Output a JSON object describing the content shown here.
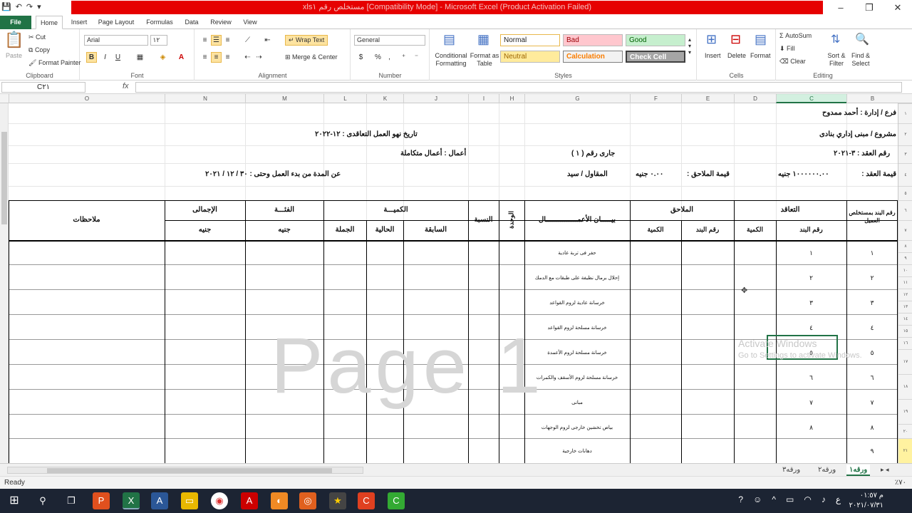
{
  "window": {
    "title": "xlsمستخلص رقم ١ [Compatibility Mode] - Microsoft Excel (Product Activation Failed)",
    "minimize": "‒",
    "restore": "❐",
    "close": "✕"
  },
  "qat": {
    "save": "💾",
    "undo": "↶",
    "redo": "↷",
    "more": "▾"
  },
  "ribbon_tabs": [
    "File",
    "Home",
    "Insert",
    "Page Layout",
    "Formulas",
    "Data",
    "Review",
    "View"
  ],
  "clipboard": {
    "paste": "Paste",
    "cut": "Cut",
    "copy": "Copy",
    "format_painter": "Format Painter",
    "label": "Clipboard"
  },
  "font": {
    "name": "Arial",
    "size": "١٢",
    "bold": "B",
    "italic": "I",
    "underline": "U",
    "label": "Font"
  },
  "alignment": {
    "wrap_text": "Wrap Text",
    "merge_center": "Merge & Center",
    "label": "Alignment"
  },
  "number": {
    "format": "General",
    "percent": "%",
    "comma": ",",
    "label": "Number"
  },
  "styles": {
    "conditional": "Conditional Formatting",
    "format_table": "Format as Table",
    "normal": "Normal",
    "bad": "Bad",
    "good": "Good",
    "neutral": "Neutral",
    "calculation": "Calculation",
    "check_cell": "Check Cell",
    "label": "Styles"
  },
  "cells": {
    "insert": "Insert",
    "delete": "Delete",
    "format": "Format",
    "label": "Cells"
  },
  "editing": {
    "autosum": "AutoSum",
    "fill": "Fill",
    "clear": "Clear",
    "sort": "Sort & Filter",
    "find": "Find & Select",
    "label": "Editing"
  },
  "formula_bar": {
    "name_box": "C٢١",
    "fx": "fx",
    "value": ""
  },
  "columns": [
    "O",
    "N",
    "M",
    "L",
    "K",
    "J",
    "I",
    "H",
    "G",
    "F",
    "E",
    "D",
    "C",
    "B"
  ],
  "rows": [
    "١",
    "٢",
    "٣",
    "٤",
    "٥",
    "٦",
    "٧",
    "٨",
    "٩",
    "١٠",
    "١١",
    "١٢",
    "١٣",
    "١٤",
    "١٥",
    "١٦",
    "١٧",
    "١٨",
    "١٩",
    "٢٠",
    "٢١"
  ],
  "sheet": {
    "branch": "فرع / إدارة : أحمد ممدوح",
    "project": "مشروع / مبنى إداري بنادى",
    "period_end": "تاريخ نهو العمل التعاقدى : ١٢-٢٠٢٢",
    "contract_no": "رقم العقد : ٣-٢٠٢١",
    "running": "جارى  رقم  (  ١  )",
    "works": "أعمال : أعمال متكاملة",
    "contract_value_label": "قيمة العقد :",
    "contract_value": "١٠٠٠٠٠٠.٠٠ جنيه",
    "addendum_label": "قيمة الملاحق :",
    "addendum_value": "٠.٠٠ جنيه",
    "contractor": "المقاول / سيد",
    "duration": "عن المدة من بدء العمل وحتى :  ٣٠ /  ١٢  /  ٢٠٢١",
    "headers": {
      "item_no": "رقم البند بمستخلص العميل",
      "contract": "التعاقد",
      "contract_item": "رقم البند",
      "contract_qty": "الكمية",
      "addenda": "الملاحق",
      "addenda_item": "رقم البند",
      "addenda_qty": "الكمية",
      "description": "بيـــــان الأعمـــــــــــــــال",
      "unit": "الوحدة",
      "ratio": "النسبة",
      "quantity": "الكميـــة",
      "previous": "السابقة",
      "current": "الحالية",
      "total_qty": "الجملة",
      "rate": "الفئـــة",
      "rate_unit": "جنيه",
      "total": "الإجمالى",
      "total_unit": "جنيه",
      "notes": "ملاحظات"
    },
    "items": [
      {
        "no": "١",
        "item": "١",
        "desc": "حفر فى تربة عادية"
      },
      {
        "no": "٢",
        "item": "٢",
        "desc": "إحلال برمال نظيفة على طبقات مع الدمك"
      },
      {
        "no": "٣",
        "item": "٣",
        "desc": "خرسانة عادية لزوم القواعد"
      },
      {
        "no": "٤",
        "item": "٤",
        "desc": "خرسانة مسلحة لزوم القواعد"
      },
      {
        "no": "٥",
        "item": "٥",
        "desc": "خرسانة مسلحة لزوم الأعمدة"
      },
      {
        "no": "٦",
        "item": "٦",
        "desc": "خرسانة مسلحة لزوم الأسقف والكمرات"
      },
      {
        "no": "٧",
        "item": "٧",
        "desc": "مبانى"
      },
      {
        "no": "٨",
        "item": "٨",
        "desc": "بياض تخشين خارجى لزوم الوجهات"
      },
      {
        "no": "٩",
        "item": "",
        "desc": "دهانات خارجية"
      }
    ],
    "watermark": "Page 1"
  },
  "activation": {
    "line1": "Activate Windows",
    "line2": "Go to Settings to activate Windows."
  },
  "sheet_tabs": [
    "ورقه١",
    "ورقه٢",
    "ورقه٣"
  ],
  "status": {
    "ready": "Ready",
    "zoom": "٧٠٪"
  },
  "taskbar": {
    "time": "م ٠١:٥٧",
    "date": "٢٠٢١/٠٧/٣١",
    "lang": "ع"
  }
}
